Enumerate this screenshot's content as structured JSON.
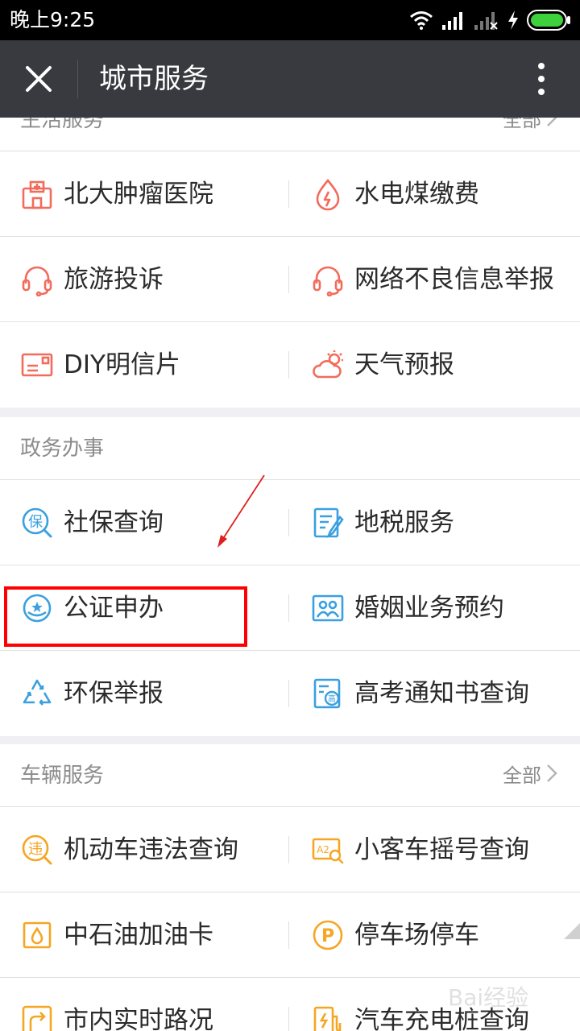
{
  "status_bar": {
    "time": "晚上9:25"
  },
  "title_bar": {
    "title": "城市服务"
  },
  "sections": [
    {
      "title": "生活服务",
      "all_label": "全部",
      "items": [
        {
          "label": "北大肿瘤医院",
          "icon": "hospital-icon"
        },
        {
          "label": "水电煤缴费",
          "icon": "water-drop-icon"
        },
        {
          "label": "旅游投诉",
          "icon": "headset-icon"
        },
        {
          "label": "网络不良信息举报",
          "icon": "headset-icon"
        },
        {
          "label": "DIY明信片",
          "icon": "postcard-icon"
        },
        {
          "label": "天气预报",
          "icon": "weather-icon"
        }
      ]
    },
    {
      "title": "政务办事",
      "items": [
        {
          "label": "社保查询",
          "icon": "social-security-icon",
          "icon_text": "保"
        },
        {
          "label": "地税服务",
          "icon": "tax-document-icon"
        },
        {
          "label": "公证申办",
          "icon": "notary-seal-icon"
        },
        {
          "label": "婚姻业务预约",
          "icon": "couple-photo-icon"
        },
        {
          "label": "环保举报",
          "icon": "recycle-icon"
        },
        {
          "label": "高考通知书查询",
          "icon": "exam-notice-icon",
          "icon_text": "高"
        }
      ]
    },
    {
      "title": "车辆服务",
      "all_label": "全部",
      "items": [
        {
          "label": "机动车违法查询",
          "icon": "violation-icon",
          "icon_text": "违"
        },
        {
          "label": "小客车摇号查询",
          "icon": "lottery-icon",
          "icon_text": "A2"
        },
        {
          "label": "中石油加油卡",
          "icon": "fuel-card-icon"
        },
        {
          "label": "停车场停车",
          "icon": "parking-icon",
          "icon_text": "P"
        },
        {
          "label": "市内实时路况",
          "icon": "road-condition-icon"
        },
        {
          "label": "汽车充电桩查询",
          "icon": "charging-pile-icon"
        }
      ]
    }
  ],
  "watermark": {
    "text": "Bai经验"
  },
  "colors": {
    "life_icons": "#f26b5b",
    "gov_icons": "#3aa0e0",
    "vehicle_icons": "#f5a623",
    "highlight": "#ff0000",
    "titlebar": "#393a3f"
  }
}
